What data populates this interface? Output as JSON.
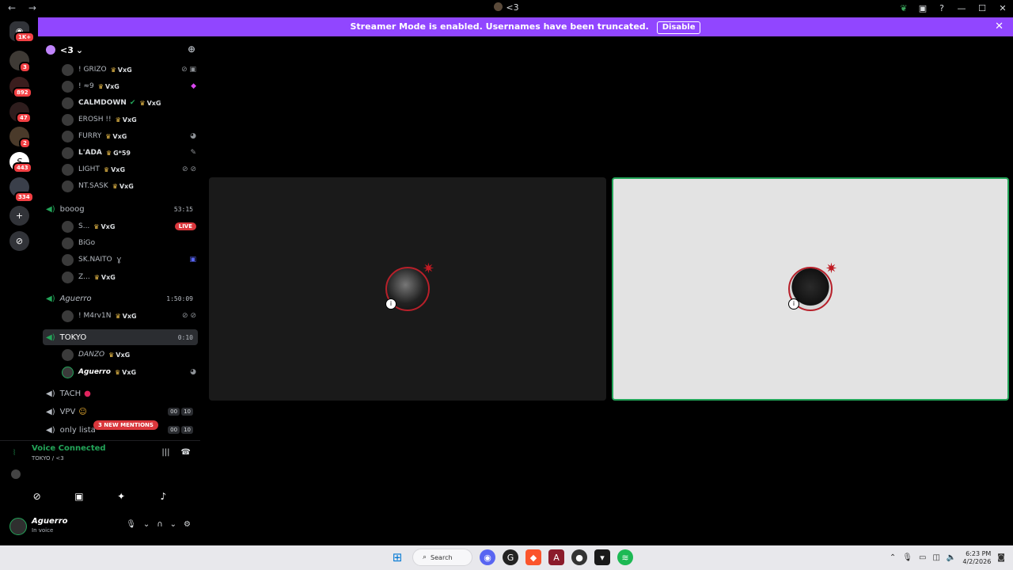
{
  "titlebar": {
    "back": "←",
    "forward": "→",
    "title": "<3"
  },
  "banner": {
    "message": "Streamer Mode is enabled. Usernames have been truncated.",
    "disable_label": "Disable",
    "close": "✕"
  },
  "guilds": [
    {
      "badge": "1K+"
    },
    {
      "badge": "3"
    },
    {
      "badge": "892"
    },
    {
      "badge": "47"
    },
    {
      "badge": "2"
    },
    {
      "badge": "443"
    },
    {
      "badge": "334"
    }
  ],
  "server": {
    "name": "<3",
    "chevron": "⌄"
  },
  "members_top": [
    {
      "name": "! GRIZO",
      "tag": "VxG"
    },
    {
      "name": "! ≈9",
      "tag": "VxG"
    },
    {
      "name": "CALMDOWN",
      "tag": "VxG"
    },
    {
      "name": "EROSH !!",
      "tag": "VxG"
    },
    {
      "name": "FURRY",
      "tag": "VxG"
    },
    {
      "name": "L'ADA",
      "tag": "G*59"
    },
    {
      "name": "LIGHT",
      "tag": "VxG"
    },
    {
      "name": "NT.SASK",
      "tag": "VxG"
    }
  ],
  "channels": {
    "booog": {
      "name": "booog",
      "time": "53:15"
    },
    "booog_members": [
      {
        "name": "S...",
        "tag": "VxG",
        "live": "LIVE"
      },
      {
        "name": "BiGo",
        "tag": ""
      },
      {
        "name": "SK.NAITO",
        "tag": ""
      },
      {
        "name": "Z...",
        "tag": "VxG"
      }
    ],
    "aguerro": {
      "name": "Aguerro",
      "time": "1:50:09"
    },
    "aguerro_members": [
      {
        "name": "! M4rv1N",
        "tag": "VxG"
      }
    ],
    "tokyo": {
      "name": "TOKYO",
      "time": "0:10"
    },
    "tokyo_members": [
      {
        "name": "DANZO",
        "tag": "VxG"
      },
      {
        "name": "Aguerro",
        "tag": "VxG"
      }
    ],
    "tach": {
      "name": "TACH"
    },
    "vpv": {
      "name": "VPV",
      "count_a": "00",
      "count_b": "10"
    },
    "only": {
      "name": "only lista",
      "count_a": "00",
      "count_b": "10"
    }
  },
  "mentions_label": "3 NEW MENTIONS",
  "voice": {
    "status": "Voice Connected",
    "location": "TOKYO / <3"
  },
  "user": {
    "name": "Aguerro",
    "status": "In voice"
  },
  "taskbar": {
    "search_label": "Search",
    "time": "6:23 PM",
    "date": "4/2/2026"
  },
  "colors": {
    "accent": "#9146ff",
    "voice_green": "#23a559",
    "live_red": "#da373c"
  }
}
